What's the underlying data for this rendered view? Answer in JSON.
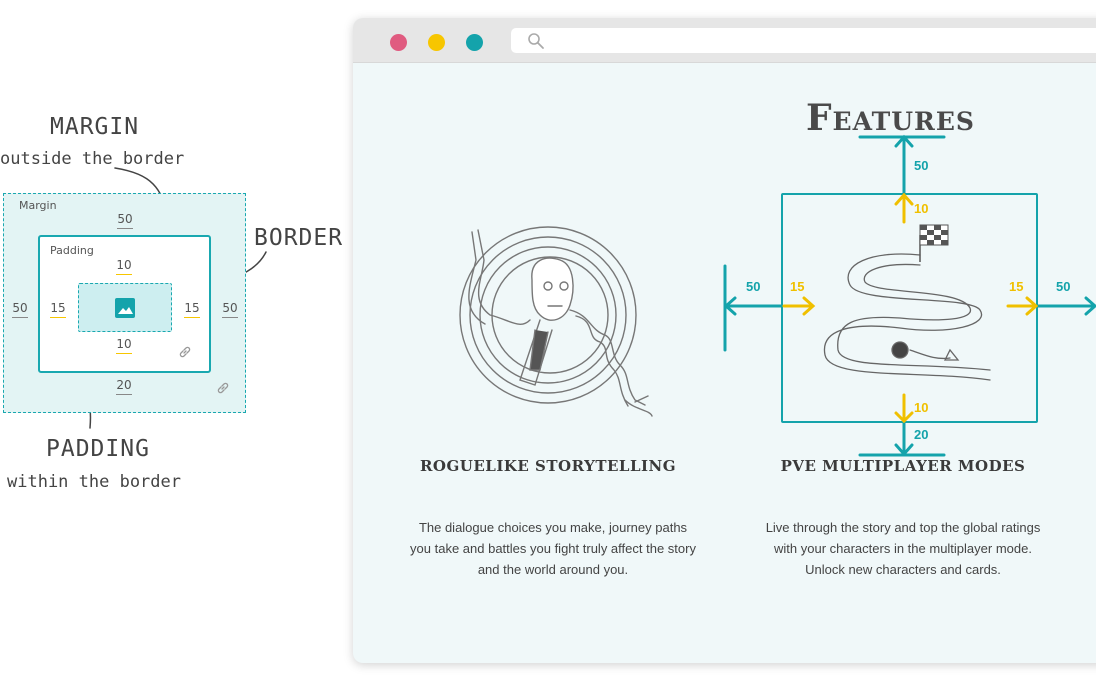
{
  "annotations": {
    "margin_title": "MARGIN",
    "margin_sub": "outside the border",
    "border_title": "BORDER",
    "padding_title": "PADDING",
    "padding_sub": "within the border"
  },
  "box_model": {
    "margin_label": "Margin",
    "padding_label": "Padding",
    "margin_top": "50",
    "margin_bottom": "20",
    "margin_left": "50",
    "margin_right": "50",
    "padding_top": "10",
    "padding_bottom": "10",
    "padding_left": "15",
    "padding_right": "15",
    "image_icon": "image-icon",
    "link_icon": "link-icon"
  },
  "browser": {
    "window_controls": [
      "close-dot",
      "minimize-dot",
      "maximize-dot"
    ],
    "dot_colors": [
      "#e05b80",
      "#f7c600",
      "#14a3ab"
    ],
    "search_icon": "search-icon",
    "heading": "Features",
    "features": [
      {
        "title": "ROGUELIKE STORYTELLING",
        "text_lines": [
          "The dialogue choices you make, journey paths",
          "you take and battles you fight truly affect the story",
          "and the world around you."
        ]
      },
      {
        "title": "PVE MULTIPLAYER MODES",
        "text_lines": [
          "Live through the story and top the global ratings",
          "with your characters in the multiplayer mode.",
          "Unlock new characters and cards."
        ]
      }
    ],
    "spacing": {
      "margin_top": "50",
      "padding_top": "10",
      "padding_bottom": "10",
      "margin_bottom": "20",
      "margin_left": "50",
      "padding_left": "15",
      "padding_right": "15",
      "margin_right": "50"
    }
  },
  "colors": {
    "teal": "#14a3ab",
    "yellow": "#f0c000",
    "bg_light": "#f0f8f9"
  }
}
